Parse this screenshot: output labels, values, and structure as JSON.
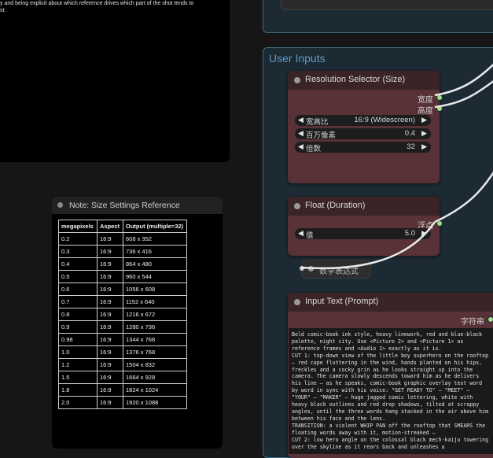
{
  "note_top": {
    "text_lines": [
      "y and being explicit about which reference drives which part of the shot tends to",
      "st."
    ]
  },
  "group": {
    "title": "User Inputs"
  },
  "resolution_node": {
    "title": "Resolution Selector (Size)",
    "outputs": [
      "宽度",
      "高度"
    ],
    "widgets": [
      {
        "label": "宽高比",
        "value": "16:9 (Widescreen)"
      },
      {
        "label": "百万像素",
        "value": "0.4"
      },
      {
        "label": "倍数",
        "value": "32"
      }
    ]
  },
  "float_node": {
    "title": "Float (Duration)",
    "output": "浮点",
    "widget": {
      "label": "值",
      "value": "5.0"
    }
  },
  "math_node": {
    "title": "数学表达式"
  },
  "prompt_node": {
    "title": "Input Text (Prompt)",
    "output": "字符串",
    "text": "Bold comic-book ink style, heavy linework, red and blue-black palette, night city. Use <Picture 2> and <Picture 1> as reference frames and <Audio 1> exactly as it is.\nCUT 1: top-down view of the little boy superhero on the rooftop — red cape fluttering in the wind, hands planted on his hips, freckles and a cocky grin as he looks straight up into the camera. The camera slowly descends toward him as he delivers his line — as he speaks, comic-book graphic overlay text word by word in sync with his voice: \"GET READY TO\" — \"MEET\" — \"YOUR\" — \"MAKER\" — huge jagged comic lettering, white with heavy black outlines and red drop shadows, tilted at scrappy angles, until the three words hang stacked in the air above him between his face and the lens.\nTRANSITION: a violent WHIP PAN off the rooftop that SMEARS the floating words away with it, motion-streaked —\nCUT 2: low hero angle on the colossal black mech-kaiju towering over the skyline as it rears back and unleashes a"
  },
  "size_note": {
    "title": "Note: Size Settings Reference",
    "headers": [
      "megapixels",
      "Aspect",
      "Output (multiple=32)"
    ],
    "rows": [
      [
        "0.2",
        "16:9",
        "608 x 352"
      ],
      [
        "0.3",
        "16:9",
        "736 x 416"
      ],
      [
        "0.4",
        "16:9",
        "864 x 480"
      ],
      [
        "0.5",
        "16:9",
        "960 x 544"
      ],
      [
        "0.6",
        "16:9",
        "1056 x 608"
      ],
      [
        "0.7",
        "16:9",
        "1152 x 640"
      ],
      [
        "0.8",
        "16:9",
        "1216 x 672"
      ],
      [
        "0.9",
        "16:9",
        "1280 x 736"
      ],
      [
        "0.98",
        "16:9",
        "1344 x 768"
      ],
      [
        "1.0",
        "16:9",
        "1376 x 768"
      ],
      [
        "1.2",
        "16:9",
        "1504 x 832"
      ],
      [
        "1.5",
        "16:9",
        "1664 x 928"
      ],
      [
        "1.8",
        "16:9",
        "1824 x 1024"
      ],
      [
        "2.0",
        "16:9",
        "1920 x 1088"
      ]
    ]
  },
  "colors": {
    "group_title": "#5f9cc6",
    "node_body": "#583236",
    "output_pin": "#9be28a"
  }
}
